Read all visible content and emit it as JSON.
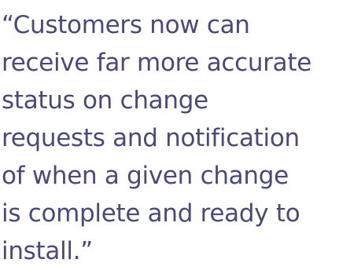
{
  "quote": {
    "lines": [
      "“Customers now can",
      "receive far more accurate",
      "status on change",
      "requests and notification",
      "of when a given change",
      "is complete and ready to",
      "install.”"
    ]
  },
  "colors": {
    "text": "#4a4a7a",
    "background": "#ffffff"
  }
}
